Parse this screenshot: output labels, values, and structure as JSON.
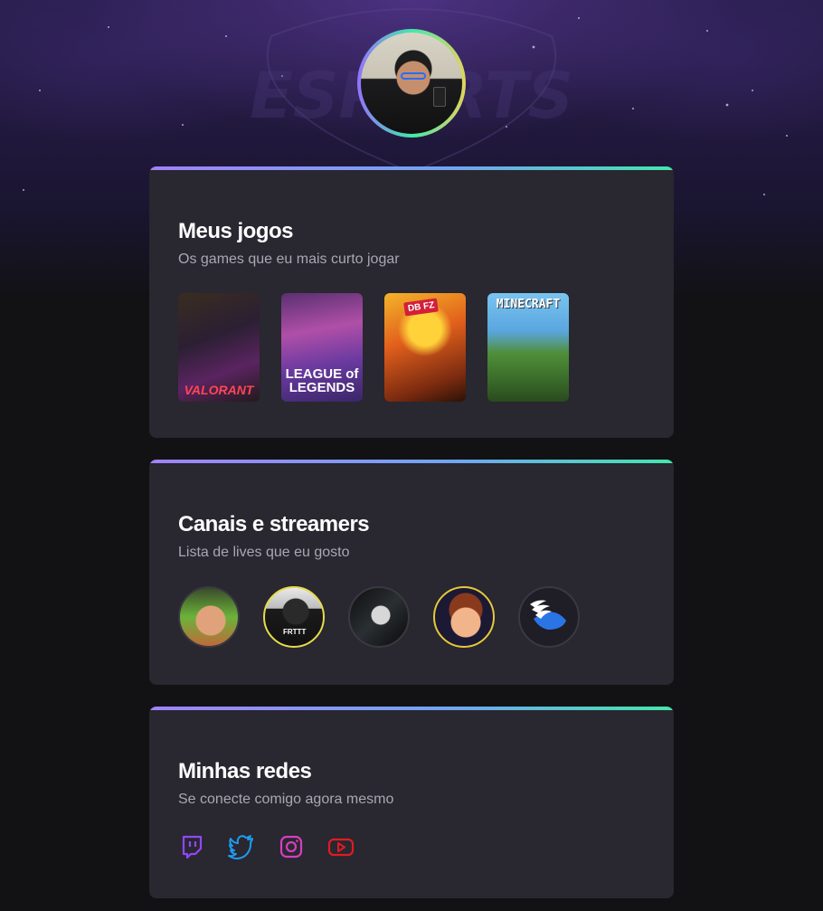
{
  "profile": {
    "avatar_alt": "profile photo"
  },
  "hero": {
    "watermark_text": "ESPORTS"
  },
  "games_card": {
    "title": "Meus jogos",
    "subtitle": "Os games que eu mais curto jogar",
    "games": [
      {
        "name": "Valorant",
        "cover_text": "VALORANT"
      },
      {
        "name": "League of Legends",
        "cover_text": "LEAGUE of LEGENDS"
      },
      {
        "name": "Dragon Ball FighterZ",
        "cover_text": ""
      },
      {
        "name": "Minecraft",
        "cover_text": "MINECRAFT"
      }
    ]
  },
  "streamers_card": {
    "title": "Canais e streamers",
    "subtitle": "Lista de lives que eu gosto",
    "streamers": [
      {
        "icon": "streamer-avatar-1"
      },
      {
        "icon": "streamer-avatar-2",
        "label": "FRTTT"
      },
      {
        "icon": "streamer-avatar-3"
      },
      {
        "icon": "streamer-avatar-4"
      },
      {
        "icon": "winged-logo-icon"
      }
    ]
  },
  "social_card": {
    "title": "Minhas redes",
    "subtitle": "Se conecte comigo agora mesmo",
    "networks": [
      {
        "icon": "twitch-icon",
        "color": "#9146ff"
      },
      {
        "icon": "twitter-icon",
        "color": "#1d9bf0"
      },
      {
        "icon": "instagram-icon",
        "color": "#d43fbf"
      },
      {
        "icon": "youtube-icon",
        "color": "#e01b24"
      }
    ]
  },
  "colors": {
    "background": "#121214",
    "card": "#29272f",
    "accent_gradient": [
      "#a182ff",
      "#6fa7f0",
      "#43e7ad"
    ],
    "title": "#ffffff",
    "subtitle": "#a8a8b3"
  }
}
